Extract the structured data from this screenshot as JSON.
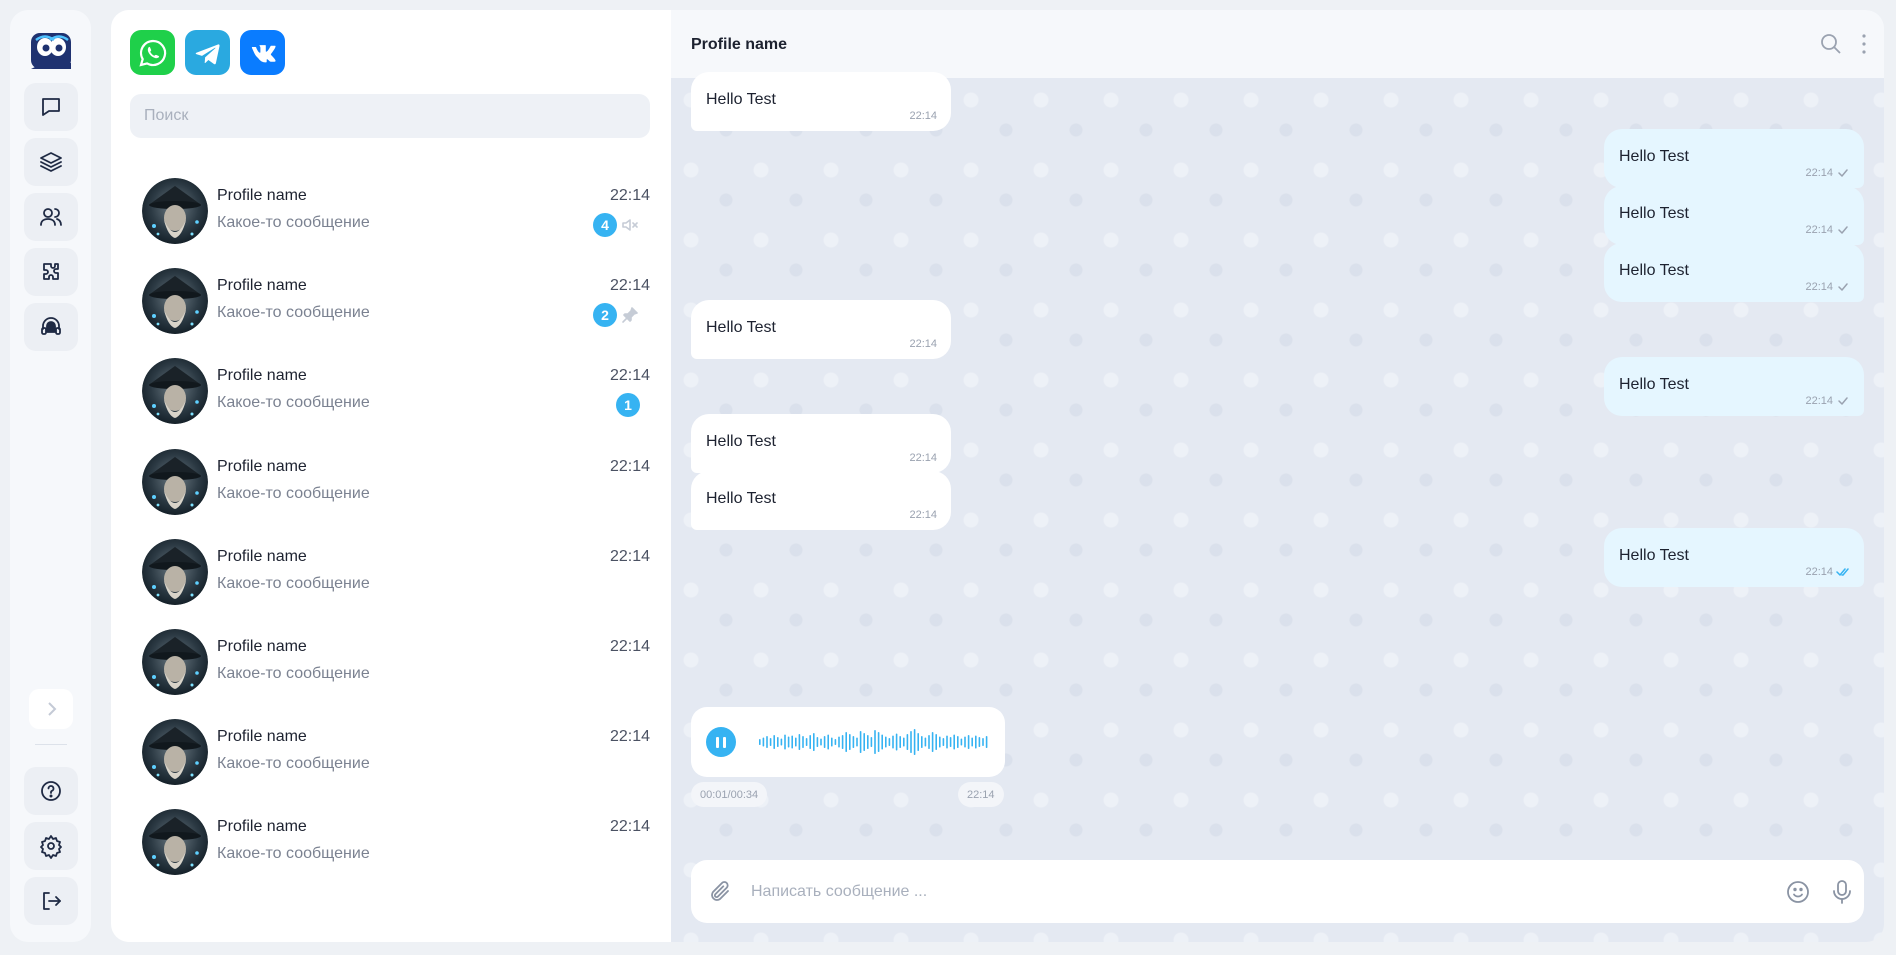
{
  "colors": {
    "accent": "#36b3f2",
    "whatsapp": "#1fd04a",
    "telegram": "#2aa9e0",
    "vk": "#0a7cff",
    "outgoing_bubble": "#e5f6ff",
    "incoming_bubble": "#ffffff",
    "chat_bg": "#e4e9f2"
  },
  "sidebar": {
    "logo": "cc-app-logo",
    "nav": [
      "chat-bubble-icon",
      "layers-icon",
      "users-icon",
      "puzzle-icon",
      "headset-icon"
    ],
    "collapse_icon": "chevron-right-icon",
    "bottom": [
      "help-circle-icon",
      "gear-icon",
      "logout-icon"
    ]
  },
  "messengers": [
    "whatsapp-icon",
    "telegram-icon",
    "vk-icon"
  ],
  "search": {
    "placeholder": "Поиск"
  },
  "chats": [
    {
      "name": "Profile name",
      "preview": "Какое-то сообщение",
      "time": "22:14",
      "unread": "4",
      "status_icon": "muted-speaker-icon"
    },
    {
      "name": "Profile name",
      "preview": "Какое-то сообщение",
      "time": "22:14",
      "unread": "2",
      "status_icon": "pin-icon"
    },
    {
      "name": "Profile name",
      "preview": "Какое-то сообщение",
      "time": "22:14",
      "unread": "1"
    },
    {
      "name": "Profile name",
      "preview": "Какое-то сообщение",
      "time": "22:14"
    },
    {
      "name": "Profile name",
      "preview": "Какое-то сообщение",
      "time": "22:14"
    },
    {
      "name": "Profile name",
      "preview": "Какое-то сообщение",
      "time": "22:14"
    },
    {
      "name": "Profile name",
      "preview": "Какое-то сообщение",
      "time": "22:14"
    },
    {
      "name": "Profile name",
      "preview": "Какое-то сообщение",
      "time": "22:14"
    }
  ],
  "conversation": {
    "title": "Profile name",
    "header_icons": [
      "search-icon",
      "more-vertical-icon"
    ],
    "messages": [
      {
        "dir": "in",
        "text": "Hello Test",
        "time": "22:14"
      },
      {
        "dir": "out",
        "text": "Hello Test",
        "time": "22:14",
        "status": "sent"
      },
      {
        "dir": "out",
        "text": "Hello Test",
        "time": "22:14",
        "status": "sent"
      },
      {
        "dir": "out",
        "text": "Hello Test",
        "time": "22:14",
        "status": "sent"
      },
      {
        "dir": "in",
        "text": "Hello Test",
        "time": "22:14"
      },
      {
        "dir": "out",
        "text": "Hello Test",
        "time": "22:14",
        "status": "sent"
      },
      {
        "dir": "in",
        "text": "Hello Test",
        "time": "22:14"
      },
      {
        "dir": "in",
        "text": "Hello Test",
        "time": "22:14"
      },
      {
        "dir": "out",
        "text": "Hello Test",
        "time": "22:14",
        "status": "read"
      }
    ],
    "voice": {
      "position": "00:01/00:34",
      "time": "22:14",
      "state": "playing"
    }
  },
  "composer": {
    "placeholder": "Написать сообщение ...",
    "icons": [
      "paperclip-icon",
      "emoji-icon",
      "microphone-icon"
    ]
  }
}
